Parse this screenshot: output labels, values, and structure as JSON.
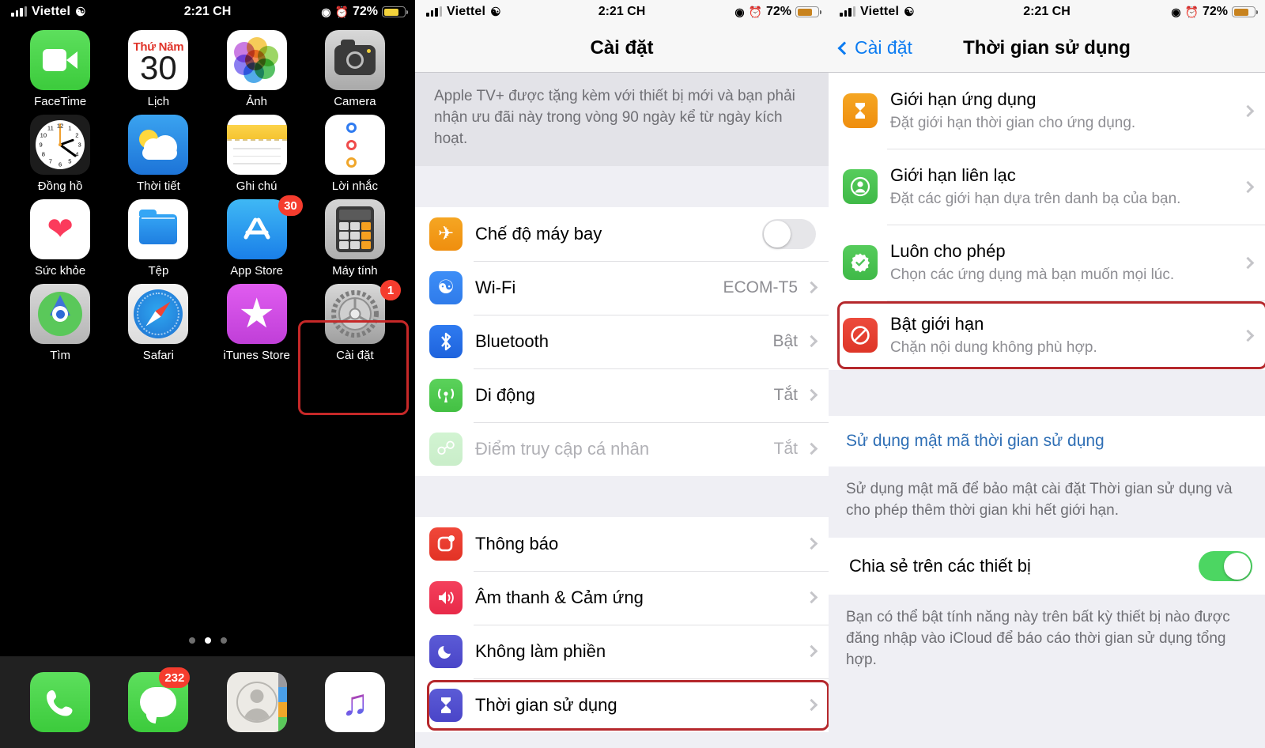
{
  "status_bar": {
    "carrier": "Viettel",
    "time": "2:21 CH",
    "battery_percent": "72%",
    "wifi_icon": "wifi-icon",
    "location_icon": "location-icon",
    "alarm_icon": "alarm-icon",
    "battery_icon": "battery-icon"
  },
  "home_screen": {
    "apps": [
      {
        "label": "FaceTime",
        "icon": "facetime-icon",
        "badge": null
      },
      {
        "label": "Lịch",
        "icon": "calendar-icon",
        "badge": null,
        "cal_weekday": "Thứ Năm",
        "cal_day": "30"
      },
      {
        "label": "Ảnh",
        "icon": "photos-icon",
        "badge": null
      },
      {
        "label": "Camera",
        "icon": "camera-icon",
        "badge": null
      },
      {
        "label": "Đồng hồ",
        "icon": "clock-icon",
        "badge": null
      },
      {
        "label": "Thời tiết",
        "icon": "weather-icon",
        "badge": null
      },
      {
        "label": "Ghi chú",
        "icon": "notes-icon",
        "badge": null
      },
      {
        "label": "Lời nhắc",
        "icon": "reminders-icon",
        "badge": null
      },
      {
        "label": "Sức khỏe",
        "icon": "health-icon",
        "badge": null
      },
      {
        "label": "Tệp",
        "icon": "files-icon",
        "badge": null
      },
      {
        "label": "App Store",
        "icon": "app-store-icon",
        "badge": "30"
      },
      {
        "label": "Máy tính",
        "icon": "calculator-icon",
        "badge": null
      },
      {
        "label": "Tìm",
        "icon": "find-my-icon",
        "badge": null
      },
      {
        "label": "Safari",
        "icon": "safari-icon",
        "badge": null
      },
      {
        "label": "iTunes Store",
        "icon": "itunes-store-icon",
        "badge": null
      },
      {
        "label": "Cài đặt",
        "icon": "settings-icon",
        "badge": "1",
        "highlighted": true
      }
    ],
    "page_dots": {
      "count": 3,
      "active_index": 1
    },
    "dock": [
      {
        "label": "Phone",
        "icon": "phone-icon",
        "badge": null
      },
      {
        "label": "Messages",
        "icon": "messages-icon",
        "badge": "232"
      },
      {
        "label": "Contacts",
        "icon": "contacts-icon",
        "badge": null
      },
      {
        "label": "Music",
        "icon": "music-icon",
        "badge": null
      }
    ]
  },
  "settings_screen": {
    "title": "Cài đặt",
    "banner": "Apple TV+ được tặng kèm với thiết bị mới và bạn phải nhận ưu đãi này trong vòng 90 ngày kể từ ngày kích hoạt.",
    "group1": [
      {
        "label": "Chế độ máy bay",
        "icon": "airplane-icon",
        "control": "toggle",
        "toggle_on": false
      },
      {
        "label": "Wi-Fi",
        "icon": "wifi-icon",
        "value": "ECOM-T5",
        "control": "chevron"
      },
      {
        "label": "Bluetooth",
        "icon": "bluetooth-icon",
        "value": "Bật",
        "control": "chevron"
      },
      {
        "label": "Di động",
        "icon": "cellular-icon",
        "value": "Tắt",
        "control": "chevron"
      },
      {
        "label": "Điểm truy cập cá nhân",
        "icon": "hotspot-icon",
        "value": "Tắt",
        "control": "chevron",
        "dimmed": true
      }
    ],
    "group2": [
      {
        "label": "Thông báo",
        "icon": "notifications-icon",
        "control": "chevron"
      },
      {
        "label": "Âm thanh & Cảm ứng",
        "icon": "sounds-icon",
        "control": "chevron"
      },
      {
        "label": "Không làm phiền",
        "icon": "do-not-disturb-icon",
        "control": "chevron"
      },
      {
        "label": "Thời gian sử dụng",
        "icon": "screen-time-icon",
        "control": "chevron",
        "highlighted": true
      }
    ]
  },
  "screen_time_screen": {
    "back_label": "Cài đặt",
    "title": "Thời gian sử dụng",
    "rows": [
      {
        "title": "Giới hạn ứng dụng",
        "subtitle": "Đặt giới hạn thời gian cho ứng dụng.",
        "icon": "hourglass-icon"
      },
      {
        "title": "Giới hạn liên lạc",
        "subtitle": "Đặt các giới hạn dựa trên danh bạ của bạn.",
        "icon": "contact-limit-icon"
      },
      {
        "title": "Luôn cho phép",
        "subtitle": "Chọn các ứng dụng mà bạn muốn mọi lúc.",
        "icon": "always-allowed-icon"
      },
      {
        "title": "Bật giới hạn",
        "subtitle": "Chặn nội dung không phù hợp.",
        "icon": "restrictions-icon",
        "highlighted": true
      }
    ],
    "passcode_link": "Sử dụng mật mã thời gian sử dụng",
    "passcode_footer": "Sử dụng mật mã để bảo mật cài đặt Thời gian sử dụng và cho phép thêm thời gian khi hết giới hạn.",
    "share_row": {
      "label": "Chia sẻ trên các thiết bị",
      "toggle_on": true
    },
    "share_footer": "Bạn có thể bật tính năng này trên bất kỳ thiết bị nào được đăng nhập vào iCloud để báo cáo thời gian sử dụng tổng hợp."
  },
  "colors": {
    "highlight_red": "#b5282c",
    "link_blue": "#0b7bf1",
    "toggle_green": "#4cd662",
    "battery_yellow": "#f2d23b"
  }
}
